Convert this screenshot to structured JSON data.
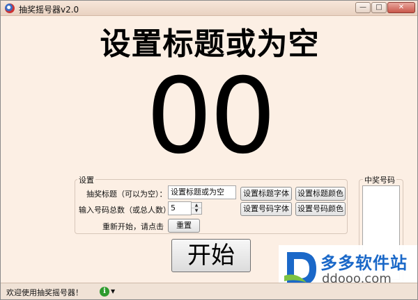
{
  "window": {
    "title": "抽奖摇号器v2.0",
    "controls": {
      "minimize": "—",
      "maximize": "□",
      "close": "✕"
    }
  },
  "display": {
    "title": "设置标题或为空",
    "number": "00"
  },
  "settings": {
    "legend": "设置",
    "title_label": "抽奖标题（可以为空）：",
    "title_value": "设置标题或为空",
    "set_title_font": "设置标题字体",
    "set_title_color": "设置标题颜色",
    "total_label": "输入号码总数（或总人数）：",
    "total_value": "5",
    "set_number_font": "设置号码字体",
    "set_number_color": "设置号码颜色",
    "restart_label": "重新开始，请点击",
    "reset_button": "重置"
  },
  "start_button": "开始",
  "winners": {
    "legend": "中奖号码"
  },
  "status": {
    "text": "欢迎使用抽奖摇号器！",
    "info_glyph": "i",
    "dropdown_glyph": "▼"
  },
  "watermark": {
    "name": "多多软件站",
    "url": "ddooo.com"
  },
  "colors": {
    "background": "#fcefe4",
    "watermark_blue": "#1a68c8"
  }
}
